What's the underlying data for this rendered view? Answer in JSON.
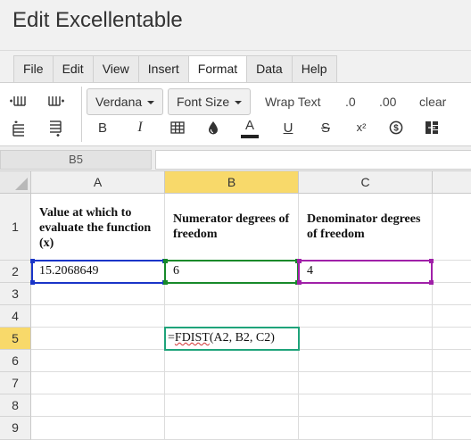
{
  "app": {
    "title": "Edit Excellentable"
  },
  "menu": {
    "tabs": [
      "File",
      "Edit",
      "View",
      "Insert",
      "Format",
      "Data",
      "Help"
    ],
    "active": "Format"
  },
  "toolbar": {
    "font_family": "Verdana",
    "font_size_label": "Font Size",
    "wrap_text": "Wrap Text",
    "decrease_decimals": ".0",
    "increase_decimals": ".00",
    "clear": "clear",
    "bold": "B",
    "italic": "I",
    "text_color_glyph": "A",
    "underline": "U",
    "strikethrough": "S",
    "superscript": "x²"
  },
  "formula_bar": {
    "cell_ref": "B5",
    "value": ""
  },
  "grid": {
    "columns": [
      "A",
      "B",
      "C"
    ],
    "selected_column": "B",
    "rows": [
      "1",
      "2",
      "3",
      "4",
      "5",
      "6",
      "7",
      "8",
      "9"
    ],
    "selected_row": "5",
    "cells": {
      "A1": "Value at which to evaluate the function (x)",
      "B1": "Numerator degrees of freedom",
      "C1": "Denominator degrees of freedom",
      "A2": "15.2068649",
      "B2": "6",
      "C2": "4"
    },
    "editing": {
      "cell": "B5",
      "formula_fn": "FDIST",
      "formula_args": "(A2, B2, C2)",
      "prefix": "="
    },
    "reference_colors": {
      "A2": "#1a35c8",
      "B2": "#178a2a",
      "C2": "#a020a8",
      "editor": "#1fa37a"
    }
  }
}
